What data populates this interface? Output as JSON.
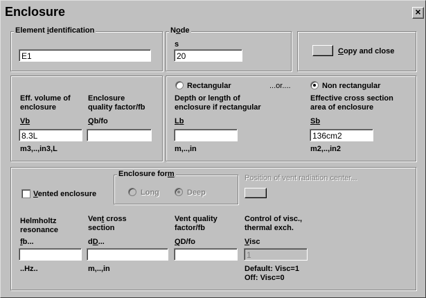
{
  "window": {
    "title": "Enclosure",
    "close_glyph": "×"
  },
  "element_identification": {
    "legend_pre": "Element ",
    "legend_u": "i",
    "legend_post": "dentification",
    "value": "E1"
  },
  "node": {
    "legend_pre": "N",
    "legend_u": "o",
    "legend_post": "de",
    "sub_label": "s",
    "value": "20"
  },
  "copy_close": {
    "label_pre": "",
    "label_u": "C",
    "label_post": "opy and close"
  },
  "volume": {
    "eff_label_line1": "Eff. volume of",
    "eff_label_line2": "enclosure",
    "vb_u": "V",
    "vb_post": "b",
    "vb_value": "8.3L",
    "vb_units": "m3,..,in3,L",
    "qual_label_line1": "Enclosure",
    "qual_label_line2": "quality factor/fb",
    "qb_u": "Q",
    "qb_post": "b/fo",
    "qb_value": ""
  },
  "shape": {
    "rect_label_pre": "Rectan",
    "rect_label_u": "g",
    "rect_label_post": "ular",
    "or_text": "...or....",
    "nonrect_label_pre": "Non rectan",
    "nonrect_label_u": "g",
    "nonrect_label_post": "ular",
    "rect_selected": false,
    "nonrect_selected": true,
    "depth_line1": "Depth or length of",
    "depth_line2": "enclosure if rectangular",
    "lb_pre": "L",
    "lb_u": "b",
    "lb_value": "",
    "lb_units": "m,..,in",
    "area_line1": "Effective cross section",
    "area_line2": "area of enclosure",
    "sb_u": "S",
    "sb_post": "b",
    "sb_value": "136cm2",
    "sb_units": "m2,..,in2"
  },
  "vent": {
    "vented_pre": "",
    "vented_u": "V",
    "vented_post": "ented enclosure",
    "vented_checked": false,
    "form_legend_pre": "Enclosure for",
    "form_legend_u": "m",
    "form_legend_post": "",
    "long_label": "Long",
    "deep_label": "Deep",
    "long_selected": false,
    "deep_selected": true,
    "position_label": "Position of vent radiation center...",
    "helm_line1": "Helmholtz",
    "helm_line2": "resonance",
    "fb_u": "f",
    "fb_post": "b...",
    "fb_value": "",
    "fb_units": "..Hz..",
    "cross_line1_pre": "Ven",
    "cross_line1_u": "t",
    "cross_line1_post": " cross",
    "cross_line2": "section",
    "dd_pre": "d",
    "dd_u": "D",
    "dd_post": "...",
    "dd_value": "",
    "dd_units": "m,..,in",
    "qual_line1": "Vent quality",
    "qual_line2": "factor/fb",
    "qd_u": "Q",
    "qd_post": "D/fo",
    "qd_value": "",
    "visc_line1": "Control of visc.,",
    "visc_line2": "thermal exch.",
    "visc_u": "V",
    "visc_post": "isc",
    "visc_value": "1",
    "default_text": "Default: Visc=1",
    "off_text": "Off: Visc=0"
  }
}
